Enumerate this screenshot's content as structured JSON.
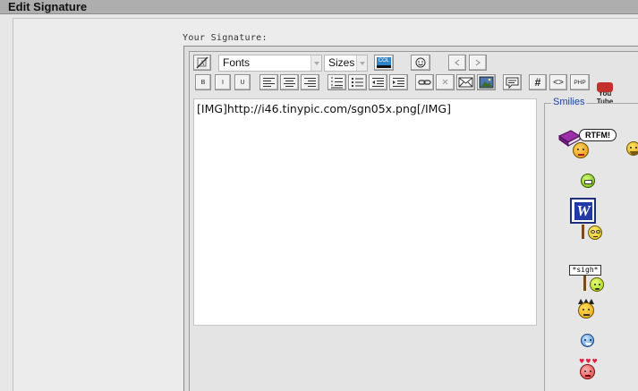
{
  "header": {
    "title": "Edit Signature"
  },
  "form": {
    "label": "Your Signature:"
  },
  "toolbar": {
    "fonts_value": "Fonts",
    "sizes_value": "Sizes",
    "color_label": "COL",
    "bold_label": "B",
    "italic_label": "I",
    "underline_label": "U",
    "php_label": "PHP",
    "hash_label": "#",
    "code_label": "<>",
    "youtube_label": "You\nTube"
  },
  "editor": {
    "content": "[IMG]http://i46.tinypic.com/sgn05x.png[/IMG]"
  },
  "smilies": {
    "legend": "Smilies",
    "rtfm_text": "RTFM!",
    "sigh_text": "*sigh*",
    "word_letter": "W"
  },
  "colors": {
    "titlebar": "#aeaeae",
    "smilies_legend": "#1a3fa8",
    "color_swatch": "#2f84c8",
    "youtube_red": "#c4302b"
  },
  "icons": [
    "remove-format-icon",
    "smiley-icon",
    "indent-icon",
    "outdent-icon",
    "align-left-icon",
    "align-center-icon",
    "align-right-icon",
    "ordered-list-icon",
    "unordered-list-icon",
    "decrease-indent-icon",
    "increase-indent-icon",
    "link-icon",
    "unlink-icon",
    "email-icon",
    "image-icon",
    "quote-icon",
    "hash-icon",
    "code-icon",
    "php-icon",
    "youtube-icon"
  ]
}
